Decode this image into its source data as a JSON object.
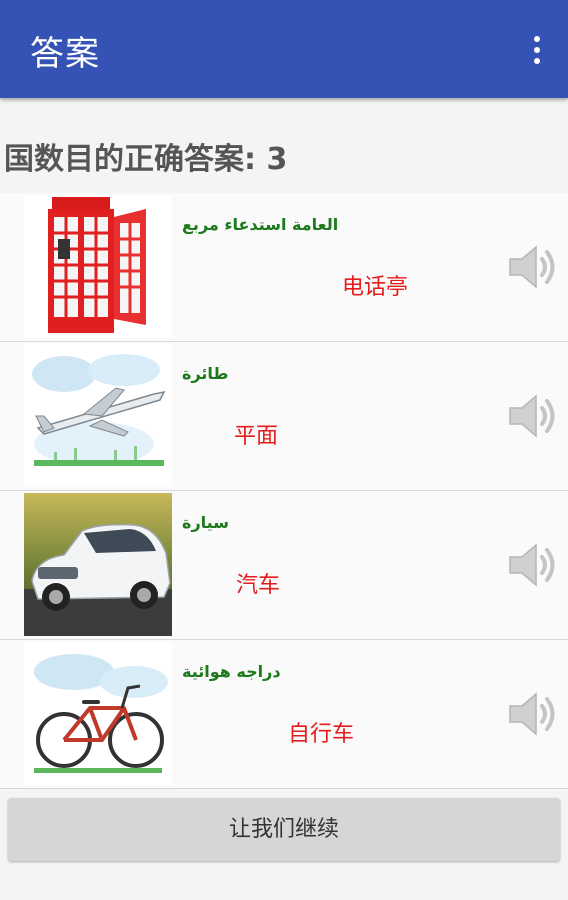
{
  "appbar": {
    "title": "答案",
    "menu_icon": "overflow-menu-icon"
  },
  "score_text": "国数目的正确答案: 3",
  "items": [
    {
      "arabic": "العامة استدعاء مربع",
      "chinese": "电话亭",
      "image": "phone-booth"
    },
    {
      "arabic": "طائرة",
      "chinese": "平面",
      "image": "airplane"
    },
    {
      "arabic": "سيارة",
      "chinese": "汽车",
      "image": "car"
    },
    {
      "arabic": "دراجه هوائية",
      "chinese": "自行车",
      "image": "bicycle"
    }
  ],
  "speaker_icon": "speaker-icon",
  "continue_button": "让我们继续"
}
